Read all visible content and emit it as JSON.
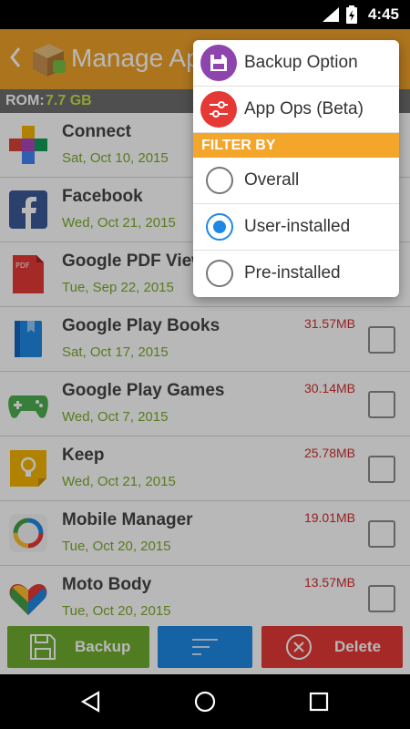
{
  "status_bar": {
    "time": "4:45"
  },
  "app_bar": {
    "title": "Manage Apps"
  },
  "rom": {
    "label": "ROM:",
    "value": "7.7 GB"
  },
  "apps": [
    {
      "name": "Connect",
      "date": "Sat, Oct 10, 2015",
      "size": "",
      "icon": "connect-icon"
    },
    {
      "name": "Facebook",
      "date": "Wed, Oct 21, 2015",
      "size": "",
      "icon": "facebook-icon"
    },
    {
      "name": "Google PDF Viewer",
      "date": "Tue, Sep 22, 2015",
      "size": "",
      "icon": "pdf-icon"
    },
    {
      "name": "Google Play Books",
      "date": "Sat, Oct 17, 2015",
      "size": "31.57MB",
      "icon": "play-books-icon"
    },
    {
      "name": "Google Play Games",
      "date": "Wed, Oct 7, 2015",
      "size": "30.14MB",
      "icon": "play-games-icon"
    },
    {
      "name": "Keep",
      "date": "Wed, Oct 21, 2015",
      "size": "25.78MB",
      "icon": "keep-icon"
    },
    {
      "name": "Mobile Manager",
      "date": "Tue, Oct 20, 2015",
      "size": "19.01MB",
      "icon": "mobile-manager-icon"
    },
    {
      "name": "Moto Body",
      "date": "Tue, Oct 20, 2015",
      "size": "13.57MB",
      "icon": "moto-body-icon"
    }
  ],
  "toolbar": {
    "backup_label": "Backup",
    "delete_label": "Delete"
  },
  "menu": {
    "backup_option": "Backup Option",
    "app_ops": "App Ops (Beta)",
    "filter_header": "FILTER BY",
    "filters": [
      {
        "label": "Overall",
        "selected": false
      },
      {
        "label": "User-installed",
        "selected": true
      },
      {
        "label": "Pre-installed",
        "selected": false
      }
    ]
  },
  "colors": {
    "app_bar": "#F0A12A",
    "date_green": "#7AAB2D",
    "size_red": "#D32F2F",
    "backup_green": "#6FAE2F",
    "sort_blue": "#1E88E5",
    "delete_red": "#E53935",
    "menu_purple": "#8E44AD",
    "menu_red": "#E53935"
  }
}
